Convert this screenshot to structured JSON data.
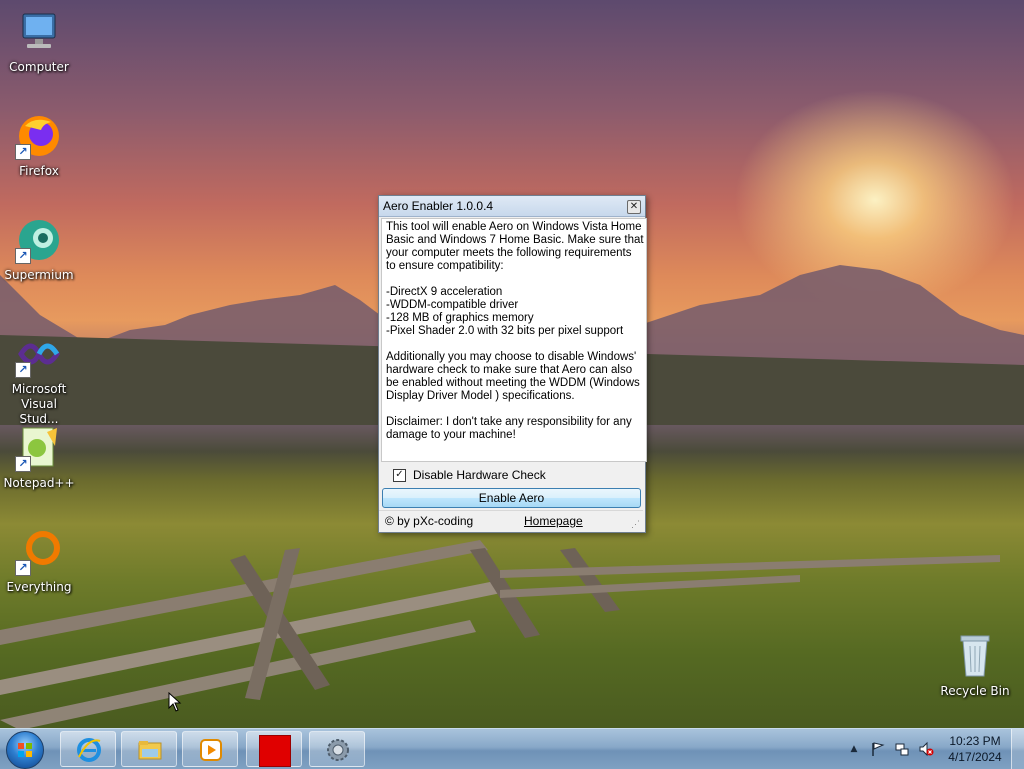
{
  "desktop": {
    "icons": [
      {
        "label": "Computer",
        "icon": "computer-icon"
      },
      {
        "label": "Firefox",
        "icon": "firefox-icon"
      },
      {
        "label": "Supermium",
        "icon": "supermium-icon"
      },
      {
        "label": "Microsoft Visual Stud...",
        "icon": "visual-studio-icon"
      },
      {
        "label": "Notepad++",
        "icon": "notepadpp-icon"
      },
      {
        "label": "Everything",
        "icon": "everything-icon"
      },
      {
        "label": "Recycle Bin",
        "icon": "recycle-bin-icon"
      }
    ]
  },
  "dialog": {
    "title": "Aero Enabler 1.0.0.4",
    "close_glyph": "✕",
    "description": "This tool will enable Aero on Windows Vista Home Basic and Windows 7 Home Basic. Make sure that your computer meets the following requirements to ensure compatibility:\n\n-DirectX 9 acceleration\n-WDDM-compatible driver\n-128 MB of graphics memory\n-Pixel Shader 2.0 with 32 bits per pixel support\n\nAdditionally you may choose to disable Windows' hardware check to make sure that Aero can also be enabled without meeting the WDDM (Windows Display Driver Model ) specifications.\n\nDisclaimer: I don't take any responsibility for any damage to your machine!",
    "checkbox_label": "Disable Hardware Check",
    "checkbox_checked": true,
    "checkbox_mark": "✓",
    "enable_button": "Enable Aero",
    "credit": "© by pXc-coding",
    "homepage_link": "Homepage"
  },
  "taskbar": {
    "buttons": [
      {
        "icon": "internet-explorer-icon"
      },
      {
        "icon": "file-explorer-icon"
      },
      {
        "icon": "media-player-icon"
      },
      {
        "icon": "red-square-app-icon"
      },
      {
        "icon": "settings-gear-icon"
      }
    ],
    "tray": {
      "chevron": "▲",
      "time": "10:23 PM",
      "date": "4/17/2024"
    }
  },
  "colors": {
    "accent": "#3c7fb1",
    "red_app": "#e00000"
  }
}
